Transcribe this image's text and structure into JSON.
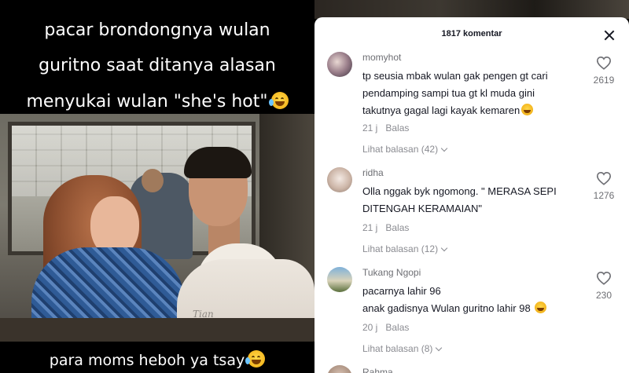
{
  "video": {
    "caption_lines": [
      "pacar brondongnya wulan",
      "guritno saat ditanya alasan",
      "menyukai wulan \"she's hot\""
    ],
    "caption_emoji": "laughing-tears-emoji",
    "bottom_caption": "para moms heboh ya tsay",
    "bottom_emoji": "laughing-tears-emoji",
    "shirt_text": "Tian"
  },
  "comments_panel": {
    "title": "1817 komentar",
    "close_icon": "close-icon",
    "comments": [
      {
        "username": "momyhot",
        "lines": [
          "tp seusia mbak wulan gak pengen gt cari",
          "pendamping sampi tua gt kl muda gini",
          "takutnya gagal lagi kayak kemaren"
        ],
        "trailing_emoji": "grinning-sweat-emoji",
        "time": "21 j",
        "reply_label": "Balas",
        "view_replies": "Lihat balasan (42)",
        "likes": "2619"
      },
      {
        "username": "ridha",
        "lines": [
          "Olla nggak byk ngomong. \" MERASA SEPI",
          "DITENGAH KERAMAIAN\""
        ],
        "time": "21 j",
        "reply_label": "Balas",
        "view_replies": "Lihat balasan (12)",
        "likes": "1276"
      },
      {
        "username": "Tukang Ngopi",
        "lines": [
          "pacarnya lahir 96",
          "anak gadisnya Wulan guritno lahir 98"
        ],
        "trailing_emoji": "grinning-sweat-emoji",
        "time": "20 j",
        "reply_label": "Balas",
        "view_replies": "Lihat balasan (8)",
        "likes": "230"
      },
      {
        "username": "Rahma"
      }
    ]
  },
  "colors": {
    "panel_bg": "#ffffff",
    "primary_text": "#161823",
    "secondary_text": "#8a8b91"
  }
}
